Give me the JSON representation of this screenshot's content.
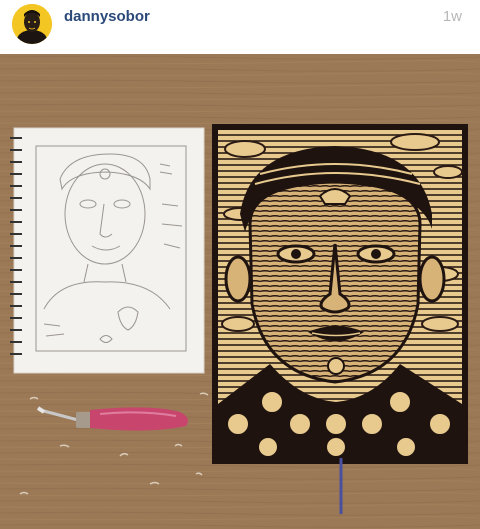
{
  "post": {
    "username": "dannysobor",
    "timestamp": "1w"
  },
  "icons": {
    "avatar": "profile-avatar-portrait",
    "photo": "post-image-sketchbook-and-linocut"
  },
  "colors": {
    "username": "#2b4a7a",
    "timestamp": "#b8b8b8",
    "avatar_bg": "#f3c623",
    "table": "#9a7854",
    "print_ink": "#2a1a14",
    "print_paper": "#e8c98e"
  }
}
